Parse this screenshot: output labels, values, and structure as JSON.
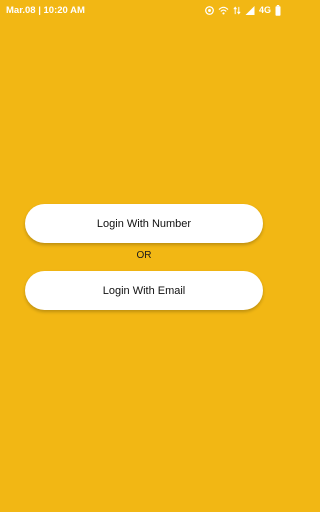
{
  "status_bar": {
    "datetime": "Mar.08 | 10:20 AM",
    "network": "4G",
    "icons": [
      "sync-icon",
      "wifi-icon",
      "data-arrows-icon",
      "signal-icon",
      "battery-icon"
    ]
  },
  "login": {
    "number_label": "Login With Number",
    "separator": "OR",
    "email_label": "Login With Email"
  },
  "colors": {
    "background": "#F2B714",
    "button": "#FFFFFF",
    "text": "#111111"
  }
}
